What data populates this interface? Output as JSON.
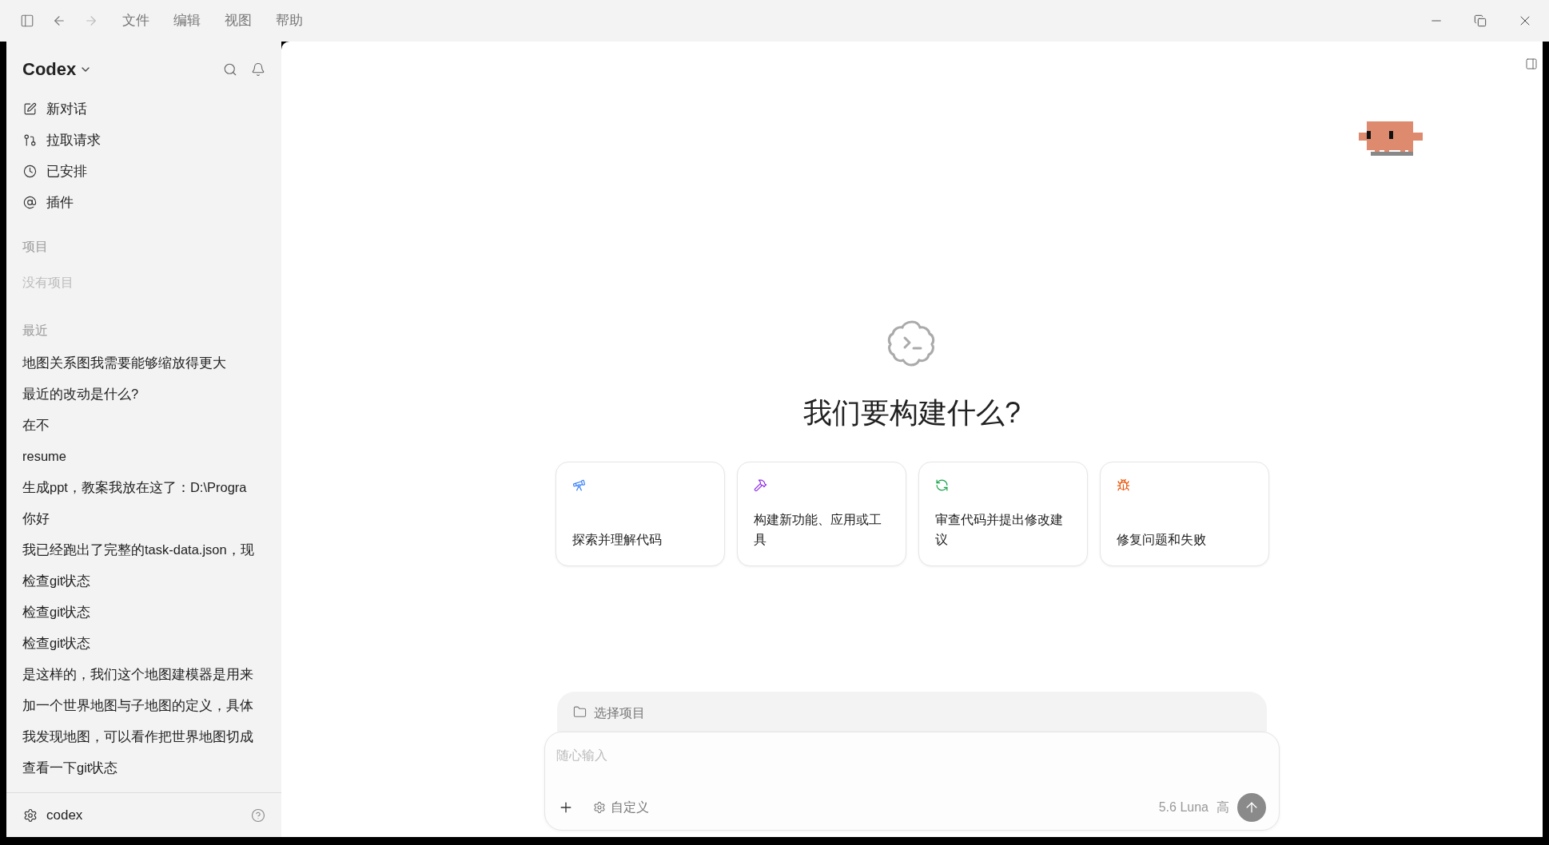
{
  "menu": [
    "文件",
    "编辑",
    "视图",
    "帮助"
  ],
  "sidebar": {
    "title": "Codex",
    "nav": [
      {
        "kind": "new",
        "label": "新对话"
      },
      {
        "kind": "pull",
        "label": "拉取请求"
      },
      {
        "kind": "scheduled",
        "label": "已安排"
      },
      {
        "kind": "plugins",
        "label": "插件"
      }
    ],
    "projects": {
      "heading": "项目",
      "empty": "没有项目"
    },
    "recent": {
      "heading": "最近",
      "items": [
        "地图关系图我需要能够缩放得更大",
        "最近的改动是什么?",
        "在不",
        "resume",
        "生成ppt，教案我放在这了：D:\\Progra",
        "你好",
        "我已经跑出了完整的task-data.json，现",
        "检查git状态",
        "检查git状态",
        "检查git状态",
        "是这样的，我们这个地图建模器是用来",
        "加一个世界地图与子地图的定义，具体",
        "我发现地图，可以看作把世界地图切成",
        "查看一下git状态"
      ]
    },
    "footer": "codex"
  },
  "main": {
    "heading": "我们要构建什么?",
    "cards": [
      {
        "kind": "explore",
        "color": "#3b82f6",
        "label": "探索并理解代码"
      },
      {
        "kind": "build",
        "color": "#9333ea",
        "label": "构建新功能、应用或工具"
      },
      {
        "kind": "review",
        "color": "#16a34a",
        "label": "审查代码并提出修改建议"
      },
      {
        "kind": "fix",
        "color": "#ea580c",
        "label": "修复问题和失败"
      }
    ],
    "project_picker": "选择项目",
    "composer": {
      "placeholder": "随心输入",
      "customize": "自定义",
      "model": "5.6 Luna",
      "effort": "高"
    }
  }
}
